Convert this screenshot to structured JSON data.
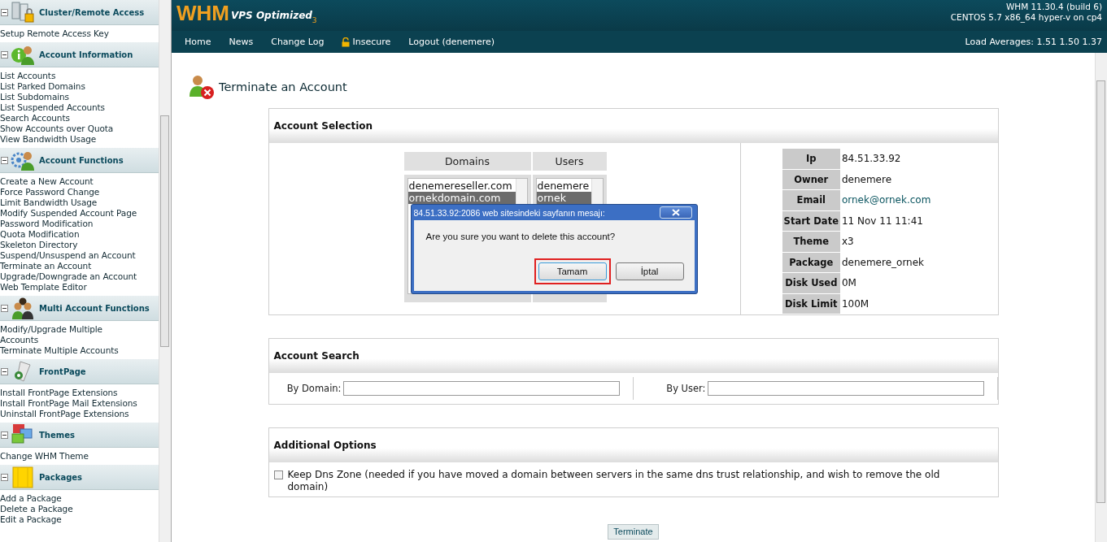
{
  "sidebar": {
    "sections": [
      {
        "kind": "cluster",
        "title": "Cluster/Remote Access",
        "expanded": true,
        "items": [
          "Setup Remote Access Key"
        ]
      },
      {
        "kind": "info",
        "title": "Account Information",
        "expanded": true,
        "items": [
          "List Accounts",
          "List Parked Domains",
          "List Subdomains",
          "List Suspended Accounts",
          "Search Accounts",
          "Show Accounts over Quota",
          "View Bandwidth Usage"
        ]
      },
      {
        "kind": "functions",
        "title": "Account Functions",
        "expanded": true,
        "items": [
          "Create a New Account",
          "Force Password Change",
          "Limit Bandwidth Usage",
          "Modify Suspended Account Page",
          "Password Modification",
          "Quota Modification",
          "Skeleton Directory",
          "Suspend/Unsuspend an Account",
          "Terminate an Account",
          "Upgrade/Downgrade an Account",
          "Web Template Editor"
        ]
      },
      {
        "kind": "multi",
        "title": "Multi Account Functions",
        "expanded": true,
        "items": [
          "Modify/Upgrade Multiple Accounts",
          "Terminate Multiple Accounts"
        ]
      },
      {
        "kind": "frontpage",
        "title": "FrontPage",
        "expanded": true,
        "items": [
          "Install FrontPage Extensions",
          "Install FrontPage Mail Extensions",
          "Uninstall FrontPage Extensions"
        ]
      },
      {
        "kind": "themes",
        "title": "Themes",
        "expanded": true,
        "items": [
          "Change WHM Theme"
        ]
      },
      {
        "kind": "packages",
        "title": "Packages",
        "expanded": true,
        "items": [
          "Add a Package",
          "Delete a Package",
          "Edit a Package"
        ]
      }
    ]
  },
  "header": {
    "logo": "WHM",
    "logo_sub": "VPS Optimized",
    "logo_version": "3",
    "version": "WHM 11.30.4 (build 6)",
    "system": "CENTOS 5.7 x86_64 hyper-v on cp4"
  },
  "nav": {
    "items": [
      {
        "kind": "link",
        "label": "Home"
      },
      {
        "kind": "link",
        "label": "News"
      },
      {
        "kind": "link",
        "label": "Change Log"
      },
      {
        "kind": "insecure",
        "label": "Insecure"
      },
      {
        "kind": "link",
        "label": "Logout (denemere)"
      }
    ],
    "load_averages": "Load Averages: 1.51 1.50 1.37"
  },
  "page_title": "Terminate an Account",
  "account_selection": {
    "title": "Account Selection",
    "domains": {
      "heading": "Domains",
      "items": [
        {
          "label": "denemereseller.com",
          "selected": false
        },
        {
          "label": "ornekdomain.com",
          "selected": true
        }
      ]
    },
    "users": {
      "heading": "Users",
      "items": [
        {
          "label": "denemere",
          "selected": false
        },
        {
          "label": "ornek",
          "selected": true
        }
      ]
    },
    "details": [
      {
        "label": "Ip",
        "value": "84.51.33.92",
        "kind": "text"
      },
      {
        "label": "Owner",
        "value": "denemere",
        "kind": "text"
      },
      {
        "label": "Email",
        "value": "ornek@ornek.com",
        "kind": "link"
      },
      {
        "label": "Start Date",
        "value": "11 Nov 11 11:41",
        "kind": "text"
      },
      {
        "label": "Theme",
        "value": "x3",
        "kind": "text"
      },
      {
        "label": "Package",
        "value": "denemere_ornek",
        "kind": "text"
      },
      {
        "label": "Disk Used",
        "value": "0M",
        "kind": "text"
      },
      {
        "label": "Disk Limit",
        "value": "100M",
        "kind": "text"
      }
    ]
  },
  "dialog": {
    "title": "84.51.33.92:2086 web sitesindeki sayfanın mesajı:",
    "message": "Are you sure you want to delete this account?",
    "buttons": [
      {
        "label": "Tamam",
        "highlighted": true
      },
      {
        "label": "İptal",
        "highlighted": false
      }
    ]
  },
  "account_search": {
    "title": "Account Search",
    "fields": [
      {
        "label": "By Domain:"
      },
      {
        "label": "By User:"
      }
    ]
  },
  "additional_options": {
    "title": "Additional Options",
    "option": {
      "label": "Keep Dns Zone (needed if you have moved a domain between servers in the same dns trust relationship, and wish to remove the old domain)",
      "checked": false
    }
  },
  "terminate_button": "Terminate"
}
